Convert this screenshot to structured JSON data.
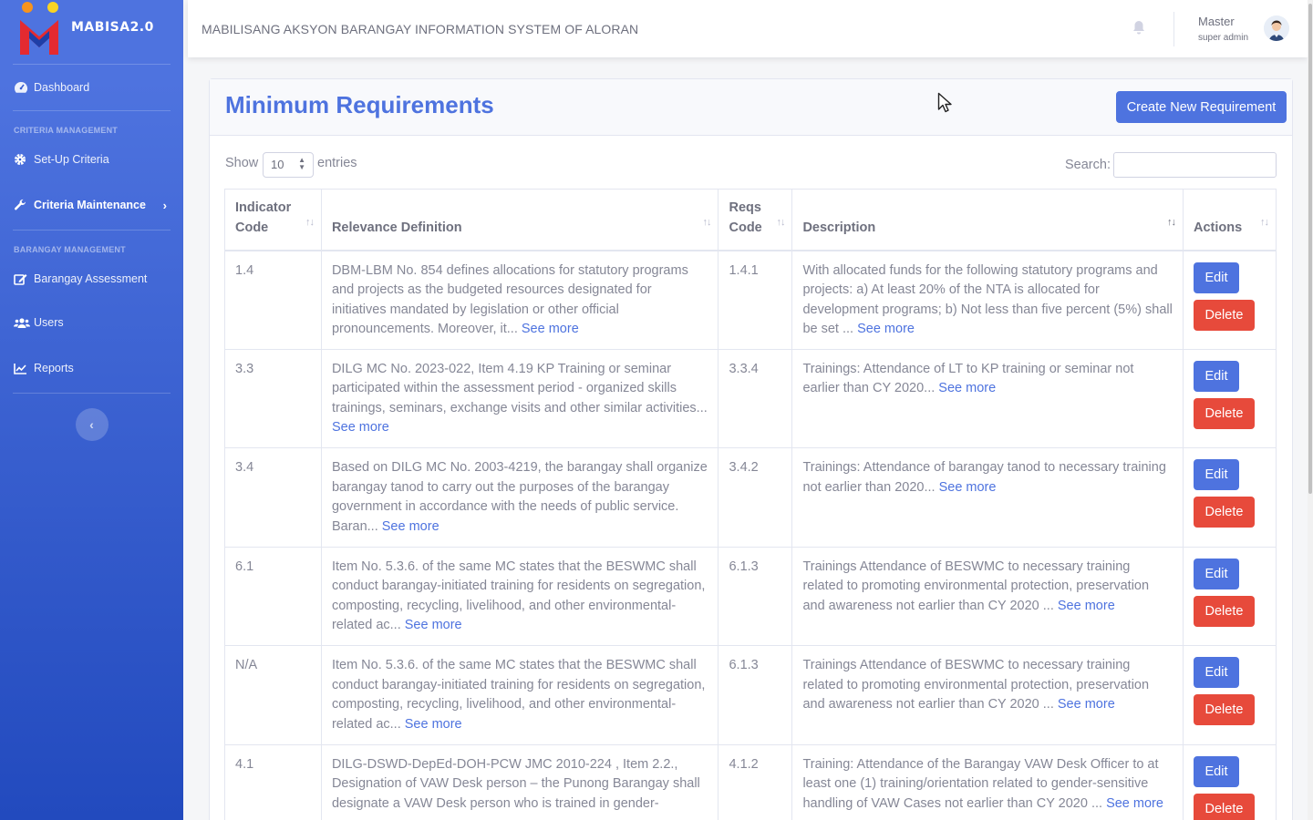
{
  "app": {
    "brand": "MABISA2.0",
    "system_title": "MABILISANG AKSYON BARANGAY INFORMATION SYSTEM OF ALORAN"
  },
  "user": {
    "name": "Master",
    "role": "super admin"
  },
  "sidebar": {
    "dashboard": "Dashboard",
    "section_criteria": "CRITERIA MANAGEMENT",
    "setup_criteria": "Set-Up Criteria",
    "criteria_maintenance": "Criteria Maintenance",
    "section_barangay": "BARANGAY MANAGEMENT",
    "barangay_assessment": "Barangay Assessment",
    "users": "Users",
    "reports": "Reports",
    "toggle_icon": "chevron-left-icon"
  },
  "page": {
    "title": "Minimum Requirements",
    "create_button": "Create New Requirement",
    "show_label": "Show",
    "entries_value": "10",
    "entries_label": "entries",
    "search_label": "Search:"
  },
  "table": {
    "headers": {
      "indicator_code": "Indicator Code",
      "relevance_definition": "Relevance Definition",
      "reqs_code": "Reqs Code",
      "description": "Description",
      "actions": "Actions"
    },
    "see_more": "See more",
    "edit_label": "Edit",
    "delete_label": "Delete",
    "rows": [
      {
        "indicator": "1.4",
        "relevance": "DBM-LBM No. 854 defines allocations for statutory programs and projects as the budgeted resources designated for initiatives mandated by legislation or other official pronouncements. Moreover, it...",
        "reqs": "1.4.1",
        "description": "With allocated funds for the following statutory programs and projects: a) At least 20% of the NTA is allocated for development programs; b) Not less than five percent (5%) shall be set ..."
      },
      {
        "indicator": "3.3",
        "relevance": "DILG MC No. 2023-022, Item 4.19 KP Training or seminar participated within the assessment period - organized skills trainings, seminars, exchange visits and other similar activities...",
        "reqs": "3.3.4",
        "description": "Trainings: Attendance of LT to KP training or seminar not earlier than CY 2020..."
      },
      {
        "indicator": "3.4",
        "relevance": "Based on DILG MC No. 2003-4219, the barangay shall organize barangay tanod to carry out the purposes of the barangay government in accordance with the needs of public service. Baran...",
        "reqs": "3.4.2",
        "description": "Trainings: Attendance of barangay tanod to necessary training not earlier than 2020..."
      },
      {
        "indicator": "6.1",
        "relevance": "Item No. 5.3.6. of the same MC states that the BESWMC shall conduct barangay-initiated training for residents on segregation, composting, recycling, livelihood, and other environmental-related ac...",
        "reqs": "6.1.3",
        "description": "Trainings Attendance of BESWMC to necessary training related to promoting environmental protection, preservation and awareness not earlier than CY 2020 ..."
      },
      {
        "indicator": "N/A",
        "relevance": "Item No. 5.3.6. of the same MC states that the BESWMC shall conduct barangay-initiated training for residents on segregation, composting, recycling, livelihood, and other environmental-related ac...",
        "reqs": "6.1.3",
        "description": "Trainings Attendance of BESWMC to necessary training related to promoting environmental protection, preservation and awareness not earlier than CY 2020 ..."
      },
      {
        "indicator": "4.1",
        "relevance": "DILG-DSWD-DepEd-DOH-PCW JMC 2010-224 , Item 2.2., Designation of VAW Desk person – the Punong Barangay shall designate a VAW Desk person who is trained in gender-",
        "reqs": "4.1.2",
        "description": "Training: Attendance of the Barangay VAW Desk Officer to at least one (1) training/orientation related to gender-sensitive handling of VAW Cases not earlier than CY 2020 ..."
      }
    ]
  }
}
